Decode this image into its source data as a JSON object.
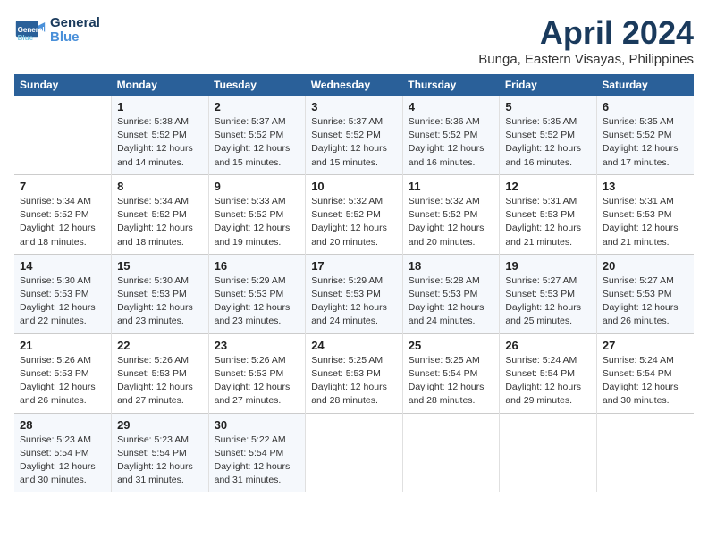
{
  "header": {
    "logo_line1": "General",
    "logo_line2": "Blue",
    "title": "April 2024",
    "subtitle": "Bunga, Eastern Visayas, Philippines"
  },
  "columns": [
    "Sunday",
    "Monday",
    "Tuesday",
    "Wednesday",
    "Thursday",
    "Friday",
    "Saturday"
  ],
  "weeks": [
    [
      {
        "day": "",
        "info": ""
      },
      {
        "day": "1",
        "info": "Sunrise: 5:38 AM\nSunset: 5:52 PM\nDaylight: 12 hours\nand 14 minutes."
      },
      {
        "day": "2",
        "info": "Sunrise: 5:37 AM\nSunset: 5:52 PM\nDaylight: 12 hours\nand 15 minutes."
      },
      {
        "day": "3",
        "info": "Sunrise: 5:37 AM\nSunset: 5:52 PM\nDaylight: 12 hours\nand 15 minutes."
      },
      {
        "day": "4",
        "info": "Sunrise: 5:36 AM\nSunset: 5:52 PM\nDaylight: 12 hours\nand 16 minutes."
      },
      {
        "day": "5",
        "info": "Sunrise: 5:35 AM\nSunset: 5:52 PM\nDaylight: 12 hours\nand 16 minutes."
      },
      {
        "day": "6",
        "info": "Sunrise: 5:35 AM\nSunset: 5:52 PM\nDaylight: 12 hours\nand 17 minutes."
      }
    ],
    [
      {
        "day": "7",
        "info": "Sunrise: 5:34 AM\nSunset: 5:52 PM\nDaylight: 12 hours\nand 18 minutes."
      },
      {
        "day": "8",
        "info": "Sunrise: 5:34 AM\nSunset: 5:52 PM\nDaylight: 12 hours\nand 18 minutes."
      },
      {
        "day": "9",
        "info": "Sunrise: 5:33 AM\nSunset: 5:52 PM\nDaylight: 12 hours\nand 19 minutes."
      },
      {
        "day": "10",
        "info": "Sunrise: 5:32 AM\nSunset: 5:52 PM\nDaylight: 12 hours\nand 20 minutes."
      },
      {
        "day": "11",
        "info": "Sunrise: 5:32 AM\nSunset: 5:52 PM\nDaylight: 12 hours\nand 20 minutes."
      },
      {
        "day": "12",
        "info": "Sunrise: 5:31 AM\nSunset: 5:53 PM\nDaylight: 12 hours\nand 21 minutes."
      },
      {
        "day": "13",
        "info": "Sunrise: 5:31 AM\nSunset: 5:53 PM\nDaylight: 12 hours\nand 21 minutes."
      }
    ],
    [
      {
        "day": "14",
        "info": "Sunrise: 5:30 AM\nSunset: 5:53 PM\nDaylight: 12 hours\nand 22 minutes."
      },
      {
        "day": "15",
        "info": "Sunrise: 5:30 AM\nSunset: 5:53 PM\nDaylight: 12 hours\nand 23 minutes."
      },
      {
        "day": "16",
        "info": "Sunrise: 5:29 AM\nSunset: 5:53 PM\nDaylight: 12 hours\nand 23 minutes."
      },
      {
        "day": "17",
        "info": "Sunrise: 5:29 AM\nSunset: 5:53 PM\nDaylight: 12 hours\nand 24 minutes."
      },
      {
        "day": "18",
        "info": "Sunrise: 5:28 AM\nSunset: 5:53 PM\nDaylight: 12 hours\nand 24 minutes."
      },
      {
        "day": "19",
        "info": "Sunrise: 5:27 AM\nSunset: 5:53 PM\nDaylight: 12 hours\nand 25 minutes."
      },
      {
        "day": "20",
        "info": "Sunrise: 5:27 AM\nSunset: 5:53 PM\nDaylight: 12 hours\nand 26 minutes."
      }
    ],
    [
      {
        "day": "21",
        "info": "Sunrise: 5:26 AM\nSunset: 5:53 PM\nDaylight: 12 hours\nand 26 minutes."
      },
      {
        "day": "22",
        "info": "Sunrise: 5:26 AM\nSunset: 5:53 PM\nDaylight: 12 hours\nand 27 minutes."
      },
      {
        "day": "23",
        "info": "Sunrise: 5:26 AM\nSunset: 5:53 PM\nDaylight: 12 hours\nand 27 minutes."
      },
      {
        "day": "24",
        "info": "Sunrise: 5:25 AM\nSunset: 5:53 PM\nDaylight: 12 hours\nand 28 minutes."
      },
      {
        "day": "25",
        "info": "Sunrise: 5:25 AM\nSunset: 5:54 PM\nDaylight: 12 hours\nand 28 minutes."
      },
      {
        "day": "26",
        "info": "Sunrise: 5:24 AM\nSunset: 5:54 PM\nDaylight: 12 hours\nand 29 minutes."
      },
      {
        "day": "27",
        "info": "Sunrise: 5:24 AM\nSunset: 5:54 PM\nDaylight: 12 hours\nand 30 minutes."
      }
    ],
    [
      {
        "day": "28",
        "info": "Sunrise: 5:23 AM\nSunset: 5:54 PM\nDaylight: 12 hours\nand 30 minutes."
      },
      {
        "day": "29",
        "info": "Sunrise: 5:23 AM\nSunset: 5:54 PM\nDaylight: 12 hours\nand 31 minutes."
      },
      {
        "day": "30",
        "info": "Sunrise: 5:22 AM\nSunset: 5:54 PM\nDaylight: 12 hours\nand 31 minutes."
      },
      {
        "day": "",
        "info": ""
      },
      {
        "day": "",
        "info": ""
      },
      {
        "day": "",
        "info": ""
      },
      {
        "day": "",
        "info": ""
      }
    ]
  ]
}
